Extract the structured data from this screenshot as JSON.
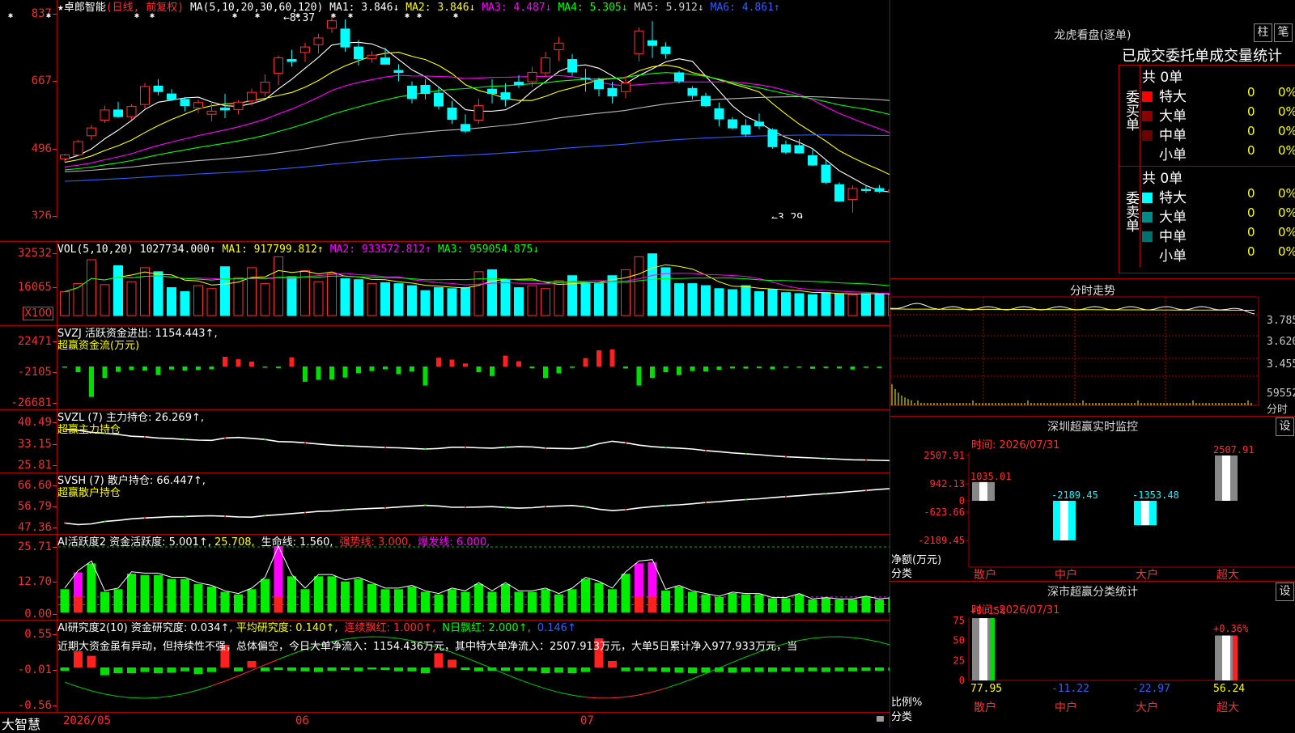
{
  "stock": {
    "name": "★卓郎智能",
    "mode": "(日线, 前复权)"
  },
  "kline": {
    "ma_params": "MA(5,10,20,30,60,120)",
    "ma": [
      {
        "label": "MA1: 3.846↓",
        "color": "#ffffff"
      },
      {
        "label": "MA2: 3.846↓",
        "color": "#ffff00"
      },
      {
        "label": "MA3: 4.487↓",
        "color": "#ff00ff"
      },
      {
        "label": "MA4: 5.305↓",
        "color": "#00ff00"
      },
      {
        "label": "MA5: 5.912↓",
        "color": "#cccccc"
      },
      {
        "label": "MA6: 4.861↑",
        "color": "#3060ff"
      }
    ],
    "ticks": [
      "837",
      "667",
      "496",
      "326"
    ],
    "high_label": "←8.37",
    "low_label": "←3.29"
  },
  "vol": {
    "title": "VOL(5,10,20)",
    "value": "1027734.000↑",
    "ma": [
      {
        "label": "MA1: 917799.812↑",
        "color": "#ffff00"
      },
      {
        "label": "MA2: 933572.812↑",
        "color": "#ff00ff"
      },
      {
        "label": "MA3: 959054.875↓",
        "color": "#00ff00"
      }
    ],
    "ticks": [
      "32532",
      "16065"
    ],
    "unit": "X100"
  },
  "svzj": {
    "title": "SVZJ  活跃资金进出: 1154.443↑,",
    "subtitle": "超赢资金流(万元)",
    "ticks": [
      "22471",
      "-2105",
      "-26681"
    ]
  },
  "svzl": {
    "title": "SVZL (7) 主力持仓: 26.269↑,",
    "subtitle": "超赢主力持仓",
    "ticks": [
      "40.49",
      "33.15",
      "25.81"
    ]
  },
  "svsh": {
    "title": "SVSH (7) 散户持仓: 66.447↑,",
    "subtitle": "超赢散户持仓",
    "ticks": [
      "66.60",
      "56.79",
      "47.36"
    ]
  },
  "ai1": {
    "title": "AI活跃度2 资金活跃度: 5.001↑,",
    "parts": [
      {
        "label": "25.708,",
        "color": "#ffff00"
      },
      {
        "label": "生命线: 1.560,",
        "color": "#ffffff"
      },
      {
        "label": "强势线: 3.000,",
        "color": "#ff3030"
      },
      {
        "label": "爆发线: 6.000,",
        "color": "#ff00ff"
      }
    ],
    "ticks": [
      "25.71",
      "12.70",
      "0.00"
    ]
  },
  "ai2": {
    "title": "AI研究度2(10) 资金研究度: 0.034↑,",
    "parts": [
      {
        "label": "平均研究度: 0.140↑,",
        "color": "#ffff00"
      },
      {
        "label": "连续飘红: 1.000↑,",
        "color": "#ff3030"
      },
      {
        "label": "N日飘红: 2.000↑,",
        "color": "#00ff00"
      },
      {
        "label": "0.146↑",
        "color": "#3060ff"
      }
    ],
    "comment": "近期大资金虽有异动，但持续性不强，总体偏空，今日大单净流入：1154.436万元，其中特大单净流入：2507.913万元，大单5日累计净入977.933万元，当",
    "ticks": [
      "0.55",
      "-0.01",
      "-0.56"
    ]
  },
  "xaxis": {
    "brand": "大智慧",
    "labels": [
      "2026/05",
      "06",
      "07"
    ]
  },
  "lhb": {
    "title": "龙虎看盘(逐单)",
    "btn1": "柱",
    "btn2": "笔",
    "subtitle": "已成交委托单成交量统计",
    "buy_label": "委买单",
    "sell_label": "委卖单",
    "buy_total": "共 0单",
    "sell_total": "共 0单",
    "buy_rows": [
      {
        "name": "特大",
        "count": "0",
        "pct": "0%",
        "color": "#ff0000"
      },
      {
        "name": "大单",
        "count": "0",
        "pct": "0%",
        "color": "#8b0000"
      },
      {
        "name": "中单",
        "count": "0",
        "pct": "0%",
        "color": "#6a0000"
      },
      {
        "name": "小单",
        "count": "0",
        "pct": "0%",
        "color": "#000000"
      }
    ],
    "sell_rows": [
      {
        "name": "特大",
        "count": "0",
        "pct": "0%",
        "color": "#00ffff"
      },
      {
        "name": "大单",
        "count": "0",
        "pct": "0%",
        "color": "#008b8b"
      },
      {
        "name": "中单",
        "count": "0",
        "pct": "0%",
        "color": "#007070"
      },
      {
        "name": "小单",
        "count": "0",
        "pct": "0%",
        "color": "#000000"
      }
    ]
  },
  "fenshi": {
    "title": "分时走势",
    "ticks": [
      "3.785",
      "3.620",
      "3.455",
      "59552"
    ],
    "unit": "分时"
  },
  "monitor": {
    "title": "深圳超赢实时监控",
    "btn": "设",
    "time": "时间: 2026/07/31",
    "ticks": [
      "2507.91",
      "942.13",
      "0",
      "-623.66",
      "-2189.45"
    ],
    "ylabel": "净额(万元)",
    "xlabel": "分类",
    "bars": [
      {
        "cat": "散户",
        "value": "1035.01"
      },
      {
        "cat": "中户",
        "value": "-2189.45"
      },
      {
        "cat": "大户",
        "value": "-1353.48"
      },
      {
        "cat": "超大",
        "value": "2507.91"
      }
    ]
  },
  "classify": {
    "title": "深市超赢分类统计",
    "btn": "设",
    "time": "时间: 2026/07/31",
    "ticks": [
      "75",
      "50",
      "25",
      "0"
    ],
    "ylabel": "比例%",
    "xlabel": "分类",
    "bars": [
      {
        "cat": "散户",
        "top": "+0.15%",
        "value": "77.95"
      },
      {
        "cat": "中户",
        "top": "",
        "value": "-11.22"
      },
      {
        "cat": "大户",
        "top": "",
        "value": "-22.97"
      },
      {
        "cat": "超大",
        "top": "+0.36%",
        "value": "56.24"
      }
    ]
  },
  "chart_data": [
    {
      "type": "candlestick",
      "title": "卓郎智能 日线",
      "ohlc": [
        [
          4.66,
          4.79,
          4.58,
          4.76
        ],
        [
          4.76,
          5.15,
          4.73,
          5.1
        ],
        [
          5.25,
          5.53,
          5.14,
          5.45
        ],
        [
          5.65,
          6.02,
          5.58,
          5.91
        ],
        [
          5.91,
          6.12,
          5.71,
          5.74
        ],
        [
          5.74,
          6.06,
          5.65,
          6.0
        ],
        [
          6.05,
          6.6,
          5.95,
          6.51
        ],
        [
          6.52,
          6.7,
          6.28,
          6.38
        ],
        [
          6.32,
          6.44,
          6.14,
          6.18
        ],
        [
          6.18,
          6.24,
          5.88,
          6.02
        ],
        [
          5.96,
          6.18,
          5.83,
          6.1
        ],
        [
          5.8,
          6.12,
          5.62,
          5.88
        ],
        [
          5.96,
          6.32,
          5.7,
          5.91
        ],
        [
          5.92,
          6.16,
          5.8,
          6.11
        ],
        [
          6.14,
          6.45,
          6.02,
          6.36
        ],
        [
          6.36,
          6.82,
          6.25,
          6.62
        ],
        [
          6.85,
          7.3,
          6.55,
          7.24
        ],
        [
          7.2,
          7.45,
          7.02,
          7.15
        ],
        [
          7.38,
          7.63,
          7.14,
          7.52
        ],
        [
          7.58,
          7.86,
          7.35,
          7.75
        ],
        [
          8.0,
          8.37,
          7.88,
          8.19
        ],
        [
          7.98,
          8.22,
          7.4,
          7.52
        ],
        [
          7.52,
          7.7,
          7.05,
          7.22
        ],
        [
          7.22,
          7.41,
          7.11,
          7.31
        ],
        [
          7.24,
          7.5,
          7.1,
          7.08
        ],
        [
          6.92,
          7.08,
          6.64,
          6.87
        ],
        [
          6.52,
          6.64,
          6.08,
          6.2
        ],
        [
          6.54,
          6.7,
          6.18,
          6.33
        ],
        [
          6.34,
          6.5,
          5.92,
          6.01
        ],
        [
          5.96,
          6.14,
          5.56,
          5.67
        ],
        [
          5.54,
          5.8,
          5.32,
          5.37
        ],
        [
          5.65,
          6.2,
          5.56,
          6.02
        ],
        [
          6.44,
          6.7,
          6.08,
          6.33
        ],
        [
          6.35,
          6.59,
          6.0,
          6.18
        ],
        [
          6.62,
          6.8,
          6.47,
          6.55
        ],
        [
          6.63,
          7.01,
          6.5,
          6.87
        ],
        [
          6.86,
          7.4,
          6.76,
          7.24
        ],
        [
          7.45,
          7.78,
          7.16,
          7.62
        ],
        [
          7.2,
          7.34,
          6.78,
          6.88
        ],
        [
          6.72,
          6.96,
          6.38,
          6.7
        ],
        [
          6.67,
          6.74,
          6.26,
          6.45
        ],
        [
          6.46,
          6.63,
          6.08,
          6.27
        ],
        [
          6.38,
          6.78,
          6.21,
          6.6
        ],
        [
          7.35,
          8.02,
          7.15,
          7.93
        ],
        [
          7.68,
          8.18,
          7.24,
          7.56
        ],
        [
          7.52,
          7.64,
          7.22,
          7.35
        ],
        [
          6.86,
          6.91,
          6.59,
          6.65
        ],
        [
          6.46,
          6.52,
          6.18,
          6.28
        ],
        [
          6.26,
          6.35,
          5.98,
          6.02
        ],
        [
          5.94,
          6.1,
          5.49,
          5.68
        ],
        [
          5.66,
          5.73,
          5.41,
          5.45
        ],
        [
          5.51,
          5.67,
          5.23,
          5.29
        ],
        [
          5.6,
          5.82,
          5.42,
          5.5
        ],
        [
          5.4,
          5.44,
          4.92,
          4.97
        ],
        [
          5.02,
          5.13,
          4.78,
          4.83
        ],
        [
          5.0,
          5.16,
          4.79,
          4.81
        ],
        [
          4.74,
          4.93,
          4.48,
          4.5
        ],
        [
          4.5,
          4.62,
          4.02,
          4.06
        ],
        [
          4.0,
          4.06,
          3.56,
          3.58
        ],
        [
          3.62,
          3.98,
          3.29,
          3.9
        ],
        [
          3.88,
          3.97,
          3.79,
          3.85
        ],
        [
          3.9,
          3.99,
          3.79,
          3.83
        ],
        [
          3.82,
          3.91,
          3.75,
          3.86
        ],
        [
          3.86,
          3.95,
          3.8,
          3.87
        ],
        [
          3.96,
          4.12,
          3.87,
          3.93
        ],
        [
          3.94,
          4.04,
          3.78,
          3.8
        ],
        [
          3.8,
          3.91,
          3.68,
          3.79
        ],
        [
          3.79,
          3.9,
          3.62,
          3.7
        ],
        [
          3.72,
          3.85,
          3.68,
          3.75
        ]
      ],
      "ma_values": {
        "MA1": 3.846,
        "MA2": 3.846,
        "MA3": 4.487,
        "MA4": 5.305,
        "MA5": 5.912,
        "MA6": 4.861
      }
    },
    {
      "type": "bar",
      "title": "VOL(5,10,20)",
      "values": [
        1.2,
        1.6,
        2.8,
        1.55,
        2.5,
        1.7,
        2.4,
        2.2,
        1.4,
        1.2,
        1.5,
        1.35,
        2.45,
        1.9,
        2.4,
        1.6,
        2.95,
        1.95,
        2.25,
        1.7,
        2.1,
        1.85,
        1.8,
        1.6,
        1.65,
        1.6,
        1.5,
        1.25,
        1.4,
        1.35,
        1.4,
        2.2,
        2.3,
        1.8,
        1.4,
        1.5,
        1.35,
        1.75,
        2.0,
        1.6,
        1.6,
        2.0,
        2.3,
        2.95,
        3.1,
        2.4,
        1.6,
        1.6,
        1.5,
        1.35,
        1.3,
        1.5,
        1.2,
        1.3,
        1.15,
        1.1,
        1.05,
        1.15,
        1.1,
        1.05,
        1.1,
        1.1,
        1.05,
        1.05,
        1.1,
        1.1,
        1.05,
        1.05,
        1.1
      ]
    },
    {
      "type": "bar",
      "title": "SVZJ 活跃资金进出",
      "values": [
        -500,
        -3000,
        -16000,
        -6000,
        -2800,
        -1800,
        -2200,
        -4500,
        -1600,
        -2200,
        -1800,
        -1500,
        5100,
        3800,
        2600,
        -500,
        -800,
        4800,
        -8000,
        -7000,
        -6800,
        -5800,
        -3500,
        -2400,
        -1500,
        -4000,
        -2600,
        -10000,
        4600,
        3600,
        1600,
        -3000,
        -5000,
        5700,
        2800,
        -900,
        -6000,
        -3600,
        -700,
        4400,
        8500,
        9000,
        -1000,
        -10000,
        -6000,
        -3000,
        -4500,
        -2400,
        -2600,
        -1700,
        -1000,
        -1100,
        -800,
        -1500,
        -700,
        -600,
        -1200,
        -800,
        -1000,
        -1600,
        -700,
        -800,
        -800,
        -1000,
        -800,
        -700,
        -800,
        -1000,
        1154.443
      ]
    },
    {
      "type": "line",
      "title": "SVZL 主力持仓",
      "values": [
        37.4,
        37.0,
        36.3,
        36.0,
        35.6,
        35.0,
        34.8,
        34.4,
        34.2,
        33.9,
        33.7,
        33.6,
        34.4,
        34.6,
        34.3,
        33.9,
        33.2,
        33.1,
        32.8,
        32.4,
        32.0,
        31.8,
        31.6,
        31.4,
        31.2,
        31.1,
        30.9,
        30.7,
        30.9,
        31.3,
        31.3,
        31.1,
        31.0,
        31.3,
        31.5,
        31.4,
        31.0,
        30.9,
        30.8,
        31.3,
        32.5,
        33.3,
        32.8,
        32.0,
        31.5,
        31.2,
        31.0,
        30.7,
        30.2,
        29.8,
        29.4,
        29.1,
        28.8,
        28.4,
        28.1,
        27.9,
        27.7,
        27.5,
        27.3,
        27.1,
        27.0,
        26.9,
        26.8,
        26.7,
        26.6,
        26.5,
        26.4,
        26.3,
        26.269
      ]
    },
    {
      "type": "line",
      "title": "SVSH 散户持仓",
      "values": [
        48.3,
        47.6,
        47.9,
        49.0,
        49.5,
        50.2,
        50.6,
        50.9,
        51.2,
        51.3,
        51.5,
        51.6,
        51.4,
        51.1,
        51.0,
        51.7,
        52.1,
        52.6,
        53.1,
        53.6,
        53.8,
        54.4,
        54.7,
        55.0,
        55.2,
        55.6,
        56.0,
        56.4,
        56.1,
        55.5,
        55.5,
        55.6,
        55.8,
        55.4,
        55.1,
        55.3,
        55.8,
        56.1,
        56.3,
        55.7,
        54.6,
        54.0,
        54.4,
        55.2,
        55.8,
        56.3,
        56.6,
        57.1,
        57.7,
        58.1,
        58.6,
        59.0,
        59.4,
        59.9,
        60.4,
        60.8,
        61.3,
        61.7,
        62.2,
        62.7,
        63.2,
        63.7,
        64.1,
        64.6,
        65.0,
        65.4,
        65.9,
        66.2,
        66.447
      ]
    },
    {
      "type": "bar",
      "title": "AI活跃度2",
      "values": [
        9,
        15.5,
        19,
        8,
        9,
        15,
        14.5,
        14.5,
        13,
        13,
        11,
        10,
        8,
        7,
        9,
        13,
        25.7,
        14,
        9,
        14,
        14,
        12,
        13,
        11,
        9,
        9,
        10,
        8,
        7,
        9,
        8,
        11,
        8,
        11,
        8,
        8,
        9,
        7,
        9,
        13,
        11.5,
        9,
        15,
        19,
        19.5,
        8.5,
        10,
        8,
        7,
        6,
        7.5,
        7,
        7,
        5.5,
        5.5,
        7,
        5,
        5.5,
        5,
        5,
        6,
        5,
        5.5,
        5.5,
        5,
        5,
        5.5,
        5,
        5.001
      ]
    },
    {
      "type": "bar",
      "title": "AI研究度2(10)",
      "values": [
        -0.05,
        0.25,
        0.18,
        -0.12,
        -0.09,
        -0.09,
        -0.07,
        -0.09,
        -0.08,
        -0.06,
        -0.1,
        -0.07,
        0.35,
        -0.06,
        0.1,
        -0.06,
        -0.04,
        -0.05,
        -0.06,
        -0.07,
        -0.05,
        -0.04,
        -0.06,
        -0.03,
        -0.04,
        -0.06,
        -0.06,
        -0.09,
        0.22,
        0.12,
        -0.04,
        -0.06,
        -0.05,
        -0.05,
        -0.05,
        -0.05,
        -0.09,
        -0.08,
        -0.09,
        -0.07,
        0.45,
        0.1,
        -0.06,
        -0.05,
        -0.06,
        -0.07,
        -0.08,
        -0.09,
        -0.08,
        -0.07,
        -0.08,
        -0.07,
        -0.07,
        -0.07,
        -0.06,
        -0.07,
        -0.06,
        -0.07,
        -0.06,
        -0.06,
        -0.05,
        -0.05,
        -0.05,
        -0.04,
        -0.05,
        -0.04,
        -0.05,
        -0.04,
        0.034
      ]
    }
  ]
}
